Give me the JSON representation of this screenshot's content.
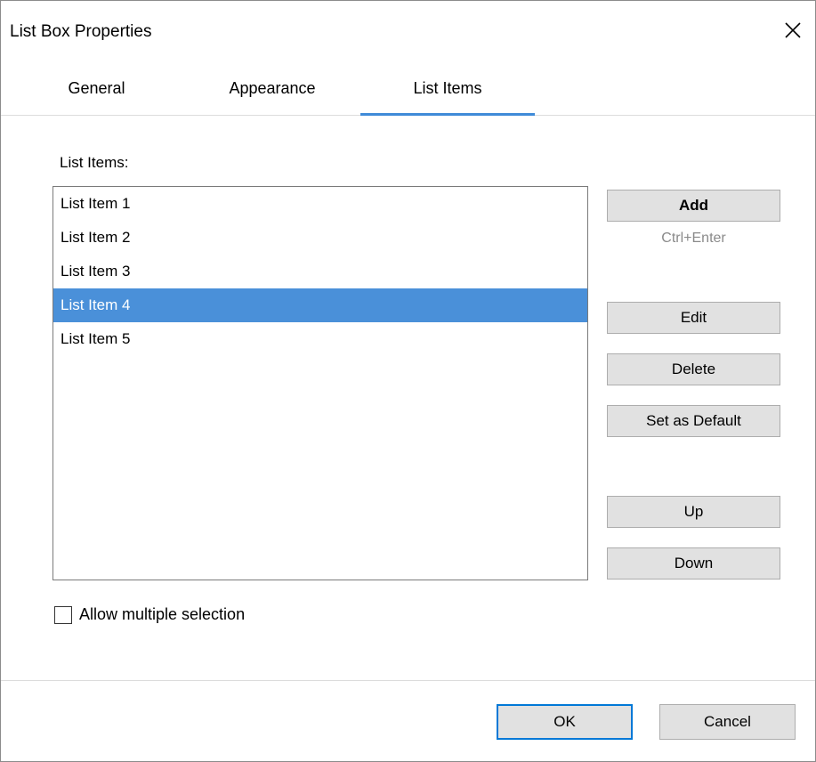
{
  "window": {
    "title": "List Box Properties"
  },
  "tabs": [
    {
      "label": "General",
      "active": false
    },
    {
      "label": "Appearance",
      "active": false
    },
    {
      "label": "List Items",
      "active": true
    }
  ],
  "list_section": {
    "label": "List Items:",
    "items": [
      "List Item 1",
      "List Item 2",
      "List Item 3",
      "List Item 4",
      "List Item 5"
    ],
    "selected_index": 3
  },
  "buttons": {
    "add": "Add",
    "add_hint": "Ctrl+Enter",
    "edit": "Edit",
    "delete": "Delete",
    "set_default": "Set as Default",
    "up": "Up",
    "down": "Down"
  },
  "options": {
    "allow_multiple_label": "Allow multiple selection",
    "allow_multiple_checked": false
  },
  "footer": {
    "ok": "OK",
    "cancel": "Cancel"
  },
  "colors": {
    "accent": "#3f8bd8",
    "selection": "#4a90d9",
    "button_bg": "#e1e1e1",
    "ok_border": "#0078d7"
  },
  "icons": {
    "close": "close-icon"
  }
}
